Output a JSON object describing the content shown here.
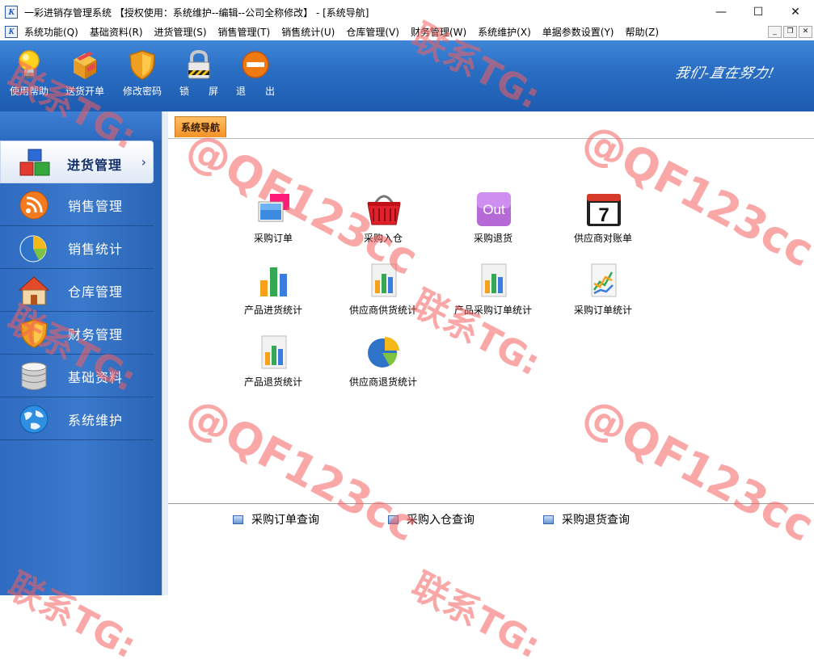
{
  "window": {
    "title": "一彩进销存管理系统 【授权使用：系统维护--编辑--公司全称修改】 - [系统导航]",
    "app_icon_text": "K",
    "minimize_glyph": "—",
    "maximize_glyph": "☐",
    "close_glyph": "✕"
  },
  "menubar": {
    "items": [
      "系统功能(Q)",
      "基础资料(R)",
      "进货管理(S)",
      "销售管理(T)",
      "销售统计(U)",
      "仓库管理(V)",
      "财务管理(W)",
      "系统维护(X)",
      "单据参数设置(Y)",
      "帮助(Z)"
    ],
    "mdi_minimize": "_",
    "mdi_restore": "❐",
    "mdi_close": "✕"
  },
  "toolbar": {
    "buttons": [
      {
        "label": "使用帮助",
        "icon": "lightbulb-icon"
      },
      {
        "label": "送货开单",
        "icon": "delivery-box-icon"
      },
      {
        "label": "修改密码",
        "icon": "shield-icon"
      },
      {
        "label": "锁　　屏",
        "icon": "lock-icon"
      },
      {
        "label": "退　　出",
        "icon": "exit-icon"
      }
    ],
    "slogan": "我们-直在努力!"
  },
  "sidebar": {
    "items": [
      {
        "label": "进货管理",
        "icon": "blocks-icon",
        "active": true
      },
      {
        "label": "销售管理",
        "icon": "rss-icon",
        "active": false
      },
      {
        "label": "销售统计",
        "icon": "pie-chart-icon",
        "active": false
      },
      {
        "label": "仓库管理",
        "icon": "house-icon",
        "active": false
      },
      {
        "label": "财务管理",
        "icon": "shield-icon",
        "active": false
      },
      {
        "label": "基础资料",
        "icon": "database-icon",
        "active": false
      },
      {
        "label": "系统维护",
        "icon": "globe-icon",
        "active": false
      }
    ],
    "active_arrow": "›"
  },
  "content": {
    "tab_label": "系统导航",
    "nav_icons": [
      {
        "label": "采购订单",
        "icon": "purchase-order-icon"
      },
      {
        "label": "采购入仓",
        "icon": "basket-icon"
      },
      {
        "label": "采购退货",
        "icon": "out-icon",
        "icon_text": "Out"
      },
      {
        "label": "供应商对账单",
        "icon": "calendar-icon",
        "icon_text": "7"
      },
      {
        "label": "产品进货统计",
        "icon": "bar-chart-icon"
      },
      {
        "label": "供应商供货统计",
        "icon": "report-chart-icon"
      },
      {
        "label": "产品采购订单统计",
        "icon": "report-chart-icon"
      },
      {
        "label": "采购订单统计",
        "icon": "line-chart-icon"
      },
      {
        "label": "产品退货统计",
        "icon": "report-chart-icon"
      },
      {
        "label": "供应商退货统计",
        "icon": "pie-chart-icon"
      }
    ],
    "quick_links": [
      {
        "label": "采购订单查询"
      },
      {
        "label": "采购入仓查询"
      },
      {
        "label": "采购退货查询"
      }
    ]
  },
  "watermark": {
    "line1": "联系TG:",
    "line2": "@QF123cc"
  },
  "colors": {
    "toolbar_blue": "#2a6fc4",
    "sidebar_blue": "#3474c8",
    "tab_orange": "#f39227",
    "watermark_red": "#f55f5f"
  }
}
